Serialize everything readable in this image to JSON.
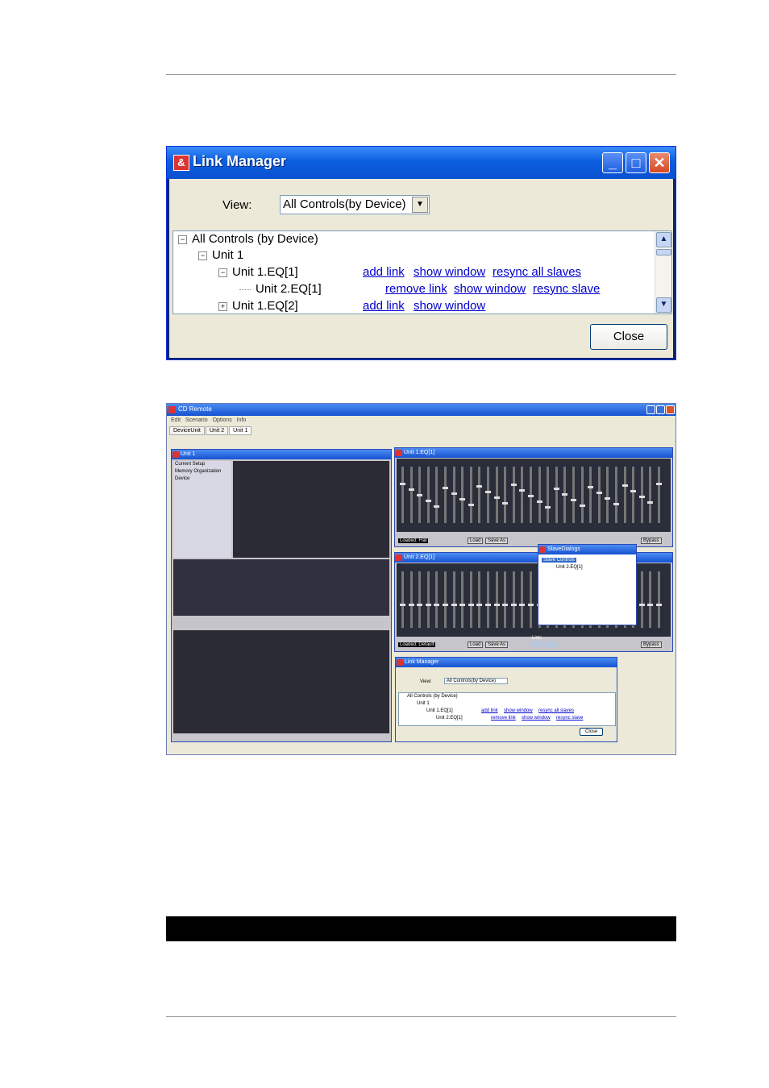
{
  "link_manager": {
    "title": "Link Manager",
    "view_label": "View:",
    "view_value": "All Controls(by Device)",
    "tree": {
      "root": "All Controls (by Device)",
      "unit1": "Unit 1",
      "eq1": "Unit 1.EQ[1]",
      "eq1_links": [
        "add link",
        "show window",
        "resync all slaves"
      ],
      "slave": "Unit 2.EQ[1]",
      "slave_links": [
        "remove link",
        "show window",
        "resync slave"
      ],
      "eq2": "Unit 1.EQ[2]",
      "eq2_links": [
        "add link",
        "show window"
      ]
    },
    "close_label": "Close"
  },
  "cd_remote": {
    "title": "CD Remote",
    "menu": "Edit  Scenario  Options  Info",
    "tabs": [
      "DeviceUnit",
      "Unit 2",
      "Unit 1"
    ],
    "unit1_window": "Unit 1",
    "unit1_tree": [
      "Current Setup",
      "Memory Organization",
      "Device"
    ],
    "eq1_window": "Unit 1.EQ[1]",
    "eq1_loaded": "Loaded: Flat",
    "eq2_window": "Unit 2.EQ[1]",
    "eq2_loaded": "Loaded: Default",
    "load_label": "Load",
    "save_label": "Save As",
    "bypass_label": "Bypass",
    "link_label": "Link:",
    "link_target": "Unit 1.EQ[1]",
    "slave_dialog": {
      "title": "SlaveDialogs",
      "root": "Slave Controls",
      "child": "Unit 2.EQ[1]"
    },
    "mini_link_manager": {
      "title": "Link Manager",
      "view_label": "View:",
      "view_value": "All Controls(by Device)",
      "rows": [
        "All Controls (by Device)",
        "Unit 1",
        "Unit 1.EQ[1]",
        "Unit 2.EQ[1]"
      ],
      "links1": [
        "add link",
        "show window",
        "resync all slaves"
      ],
      "links2": [
        "remove link",
        "show window",
        "resync slave"
      ],
      "close_label": "Close"
    }
  }
}
